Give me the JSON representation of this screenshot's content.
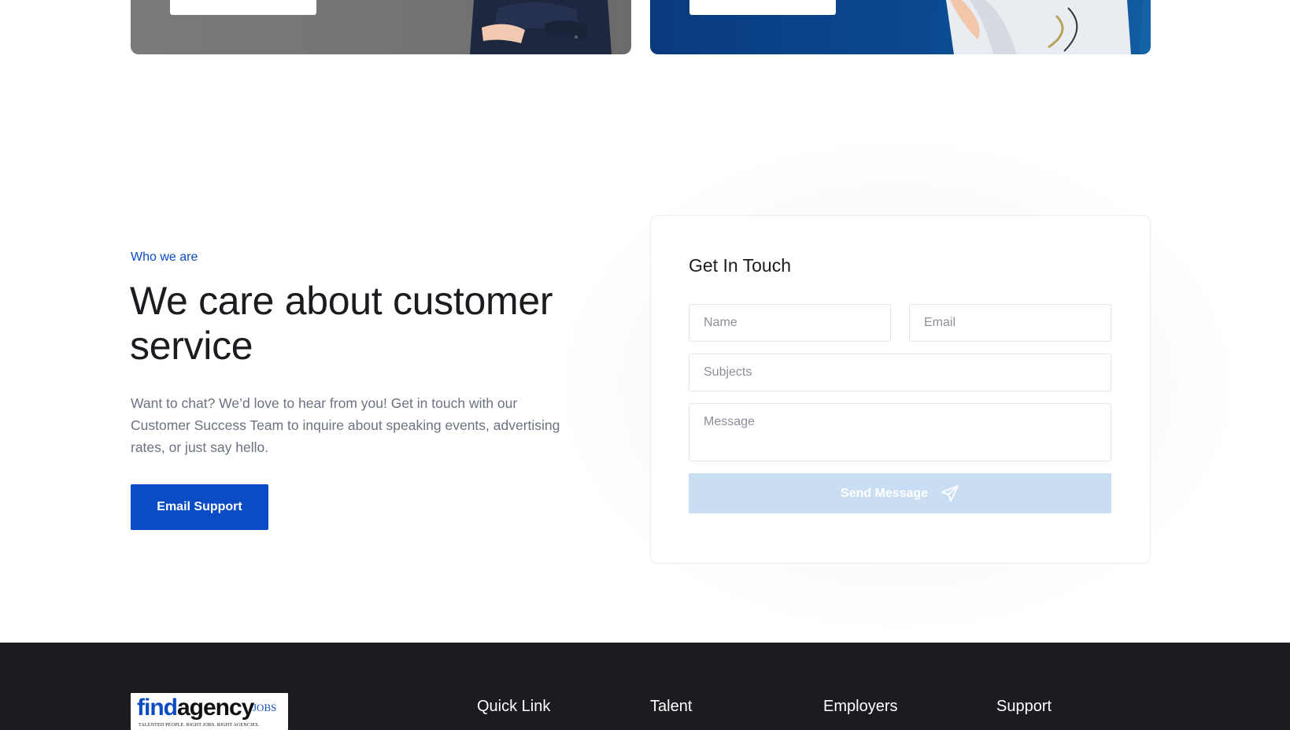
{
  "top_cards": {
    "left_button_label": "",
    "right_button_label": ""
  },
  "about": {
    "eyebrow": "Who we are",
    "headline": "We care about customer service",
    "lead": "Want to chat? We’d love to hear from you! Get in touch with our Customer Success Team to inquire about speaking events, advertising rates, or just say hello.",
    "email_button": "Email Support"
  },
  "contact": {
    "title": "Get In Touch",
    "name_placeholder": "Name",
    "email_placeholder": "Email",
    "subject_placeholder": "Subjects",
    "message_placeholder": "Message",
    "send_label": "Send Message",
    "send_icon": "paper-plane-icon"
  },
  "footer": {
    "logo": {
      "find": "find",
      "agency": "agency",
      "jobs": "JOBS",
      "tagline": "TALENTED PEOPLE. RIGHT JOBS. RIGHT AGENCIES."
    },
    "columns": [
      "Quick Link",
      "Talent",
      "Employers",
      "Support"
    ]
  },
  "colors": {
    "accent": "#0b4cc4",
    "footer_bg": "#1b1c20",
    "send_disabled": "#c9ddf3"
  }
}
